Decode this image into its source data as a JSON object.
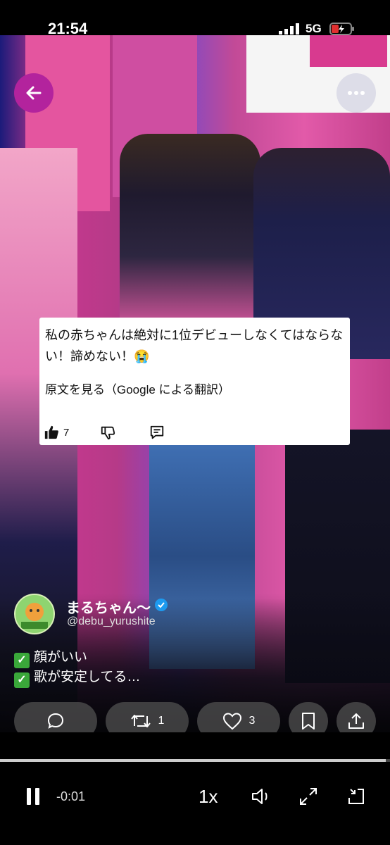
{
  "status_bar": {
    "time": "21:54",
    "network": "5G"
  },
  "comment_card": {
    "text": "私の赤ちゃんは絶対に1位デビューしなくてはならない！諦めない！😭",
    "translate_link": "原文を見る（Google による翻訳）",
    "like_count": "7"
  },
  "post": {
    "author_name": "まるちゃん〜",
    "author_handle": "@debu_yurushite",
    "line1": "顔がいい",
    "line2": "歌が安定してる…"
  },
  "actions": {
    "retweet_count": "1",
    "like_count": "3"
  },
  "player": {
    "remaining": "-0:01",
    "speed": "1x",
    "progress": 0.99
  },
  "icons": [
    "back-arrow-icon",
    "more-icon",
    "thumbs-up-icon",
    "thumbs-down-icon",
    "comment-icon",
    "reply-icon",
    "retweet-icon",
    "heart-icon",
    "bookmark-icon",
    "share-icon",
    "pause-icon",
    "volume-icon",
    "expand-icon",
    "exit-fullscreen-icon",
    "verified-icon",
    "signal-icon",
    "battery-icon"
  ],
  "colors": {
    "back_button": "#b3239d",
    "verified": "#1d9bf0",
    "check": "#3aa83a"
  }
}
